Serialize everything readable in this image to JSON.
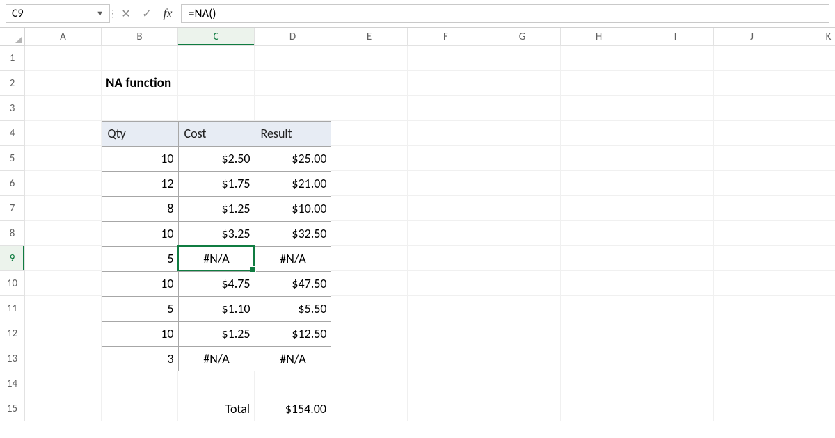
{
  "formula_bar": {
    "name_box": "C9",
    "cancel_icon": "✕",
    "accept_icon": "✓",
    "fx_label": "fx",
    "formula": "=NA()"
  },
  "columns": [
    "A",
    "B",
    "C",
    "D",
    "E",
    "F",
    "G",
    "H",
    "I",
    "J",
    "K"
  ],
  "row_numbers": [
    "1",
    "2",
    "3",
    "4",
    "5",
    "6",
    "7",
    "8",
    "9",
    "10",
    "11",
    "12",
    "13",
    "14",
    "15"
  ],
  "title": "NA function",
  "table_headers": {
    "qty": "Qty",
    "cost": "Cost",
    "result": "Result"
  },
  "rows": [
    {
      "qty": "10",
      "cost": "$2.50",
      "result": "$25.00"
    },
    {
      "qty": "12",
      "cost": "$1.75",
      "result": "$21.00"
    },
    {
      "qty": "8",
      "cost": "$1.25",
      "result": "$10.00"
    },
    {
      "qty": "10",
      "cost": "$3.25",
      "result": "$32.50"
    },
    {
      "qty": "5",
      "cost": "#N/A",
      "result": "#N/A"
    },
    {
      "qty": "10",
      "cost": "$4.75",
      "result": "$47.50"
    },
    {
      "qty": "5",
      "cost": "$1.10",
      "result": "$5.50"
    },
    {
      "qty": "10",
      "cost": "$1.25",
      "result": "$12.50"
    },
    {
      "qty": "3",
      "cost": "#N/A",
      "result": "#N/A"
    }
  ],
  "footer": {
    "label": "Total",
    "value": "$154.00"
  },
  "active_cell": "C9"
}
